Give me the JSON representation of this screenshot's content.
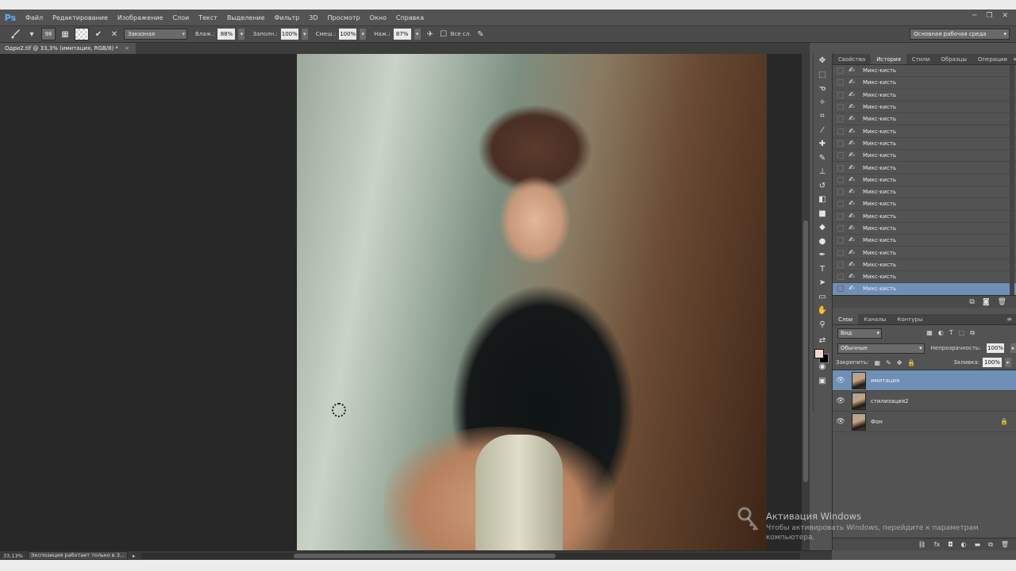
{
  "app": {
    "logo": "Ps"
  },
  "menu": [
    "Файл",
    "Редактирование",
    "Изображение",
    "Слои",
    "Текст",
    "Выделение",
    "Фильтр",
    "3D",
    "Просмотр",
    "Окно",
    "Справка"
  ],
  "window_controls": [
    "─",
    "❐",
    "✕"
  ],
  "options": {
    "brush_size": "96",
    "preset": "Заказная",
    "wet_label": "Влаж.:",
    "wet_value": "88%",
    "load_label": "Заполн.:",
    "load_value": "100%",
    "mix_label": "Смеш.:",
    "mix_value": "100%",
    "flow_label": "Наж.:",
    "flow_value": "87%",
    "sample_all_label": "Все сл.",
    "workspace": "Основная рабочая среда"
  },
  "document_tab": {
    "title": "Одри2.tif @ 33,3% (имитация, RGB/8) *",
    "close": "×"
  },
  "history_panel": {
    "tabs": [
      "Свойства",
      "История",
      "Стили",
      "Образцы",
      "Операции"
    ],
    "active_tab": 1,
    "menu_icon": "≡",
    "items": [
      "Микс-кисть",
      "Микс-кисть",
      "Микс-кисть",
      "Микс-кисть",
      "Микс-кисть",
      "Микс-кисть",
      "Микс-кисть",
      "Микс-кисть",
      "Микс-кисть",
      "Микс-кисть",
      "Микс-кисть",
      "Микс-кисть",
      "Микс-кисть",
      "Микс-кисть",
      "Микс-кисть",
      "Микс-кисть",
      "Микс-кисть",
      "Микс-кисть",
      "Микс-кисть"
    ],
    "selected_index": 18
  },
  "layers_panel": {
    "tabs": [
      "Слои",
      "Каналы",
      "Контуры"
    ],
    "active_tab": 0,
    "menu_icon": "≡",
    "kind": "Вид",
    "blend_mode": "Обычные",
    "opacity_label": "Непрозрачность:",
    "opacity": "100%",
    "lock_label": "Закрепить:",
    "fill_label": "Заливка:",
    "fill": "100%",
    "layers": [
      {
        "name": "имитация",
        "selected": true,
        "locked": false
      },
      {
        "name": "стилизация2",
        "selected": false,
        "locked": false
      },
      {
        "name": "Фон",
        "selected": false,
        "locked": true
      }
    ]
  },
  "status": {
    "zoom": "33,13%",
    "message": "Экспозиция работает только в 3..."
  },
  "watermark": {
    "title": "Активация Windows",
    "text": "Чтобы активировать Windows, перейдите к параметрам компьютера."
  },
  "colors": {
    "selection": "#6f8fb7",
    "foreground": "#f3d7c8",
    "background": "#000000",
    "ps_blue": "#5fb3ff"
  }
}
